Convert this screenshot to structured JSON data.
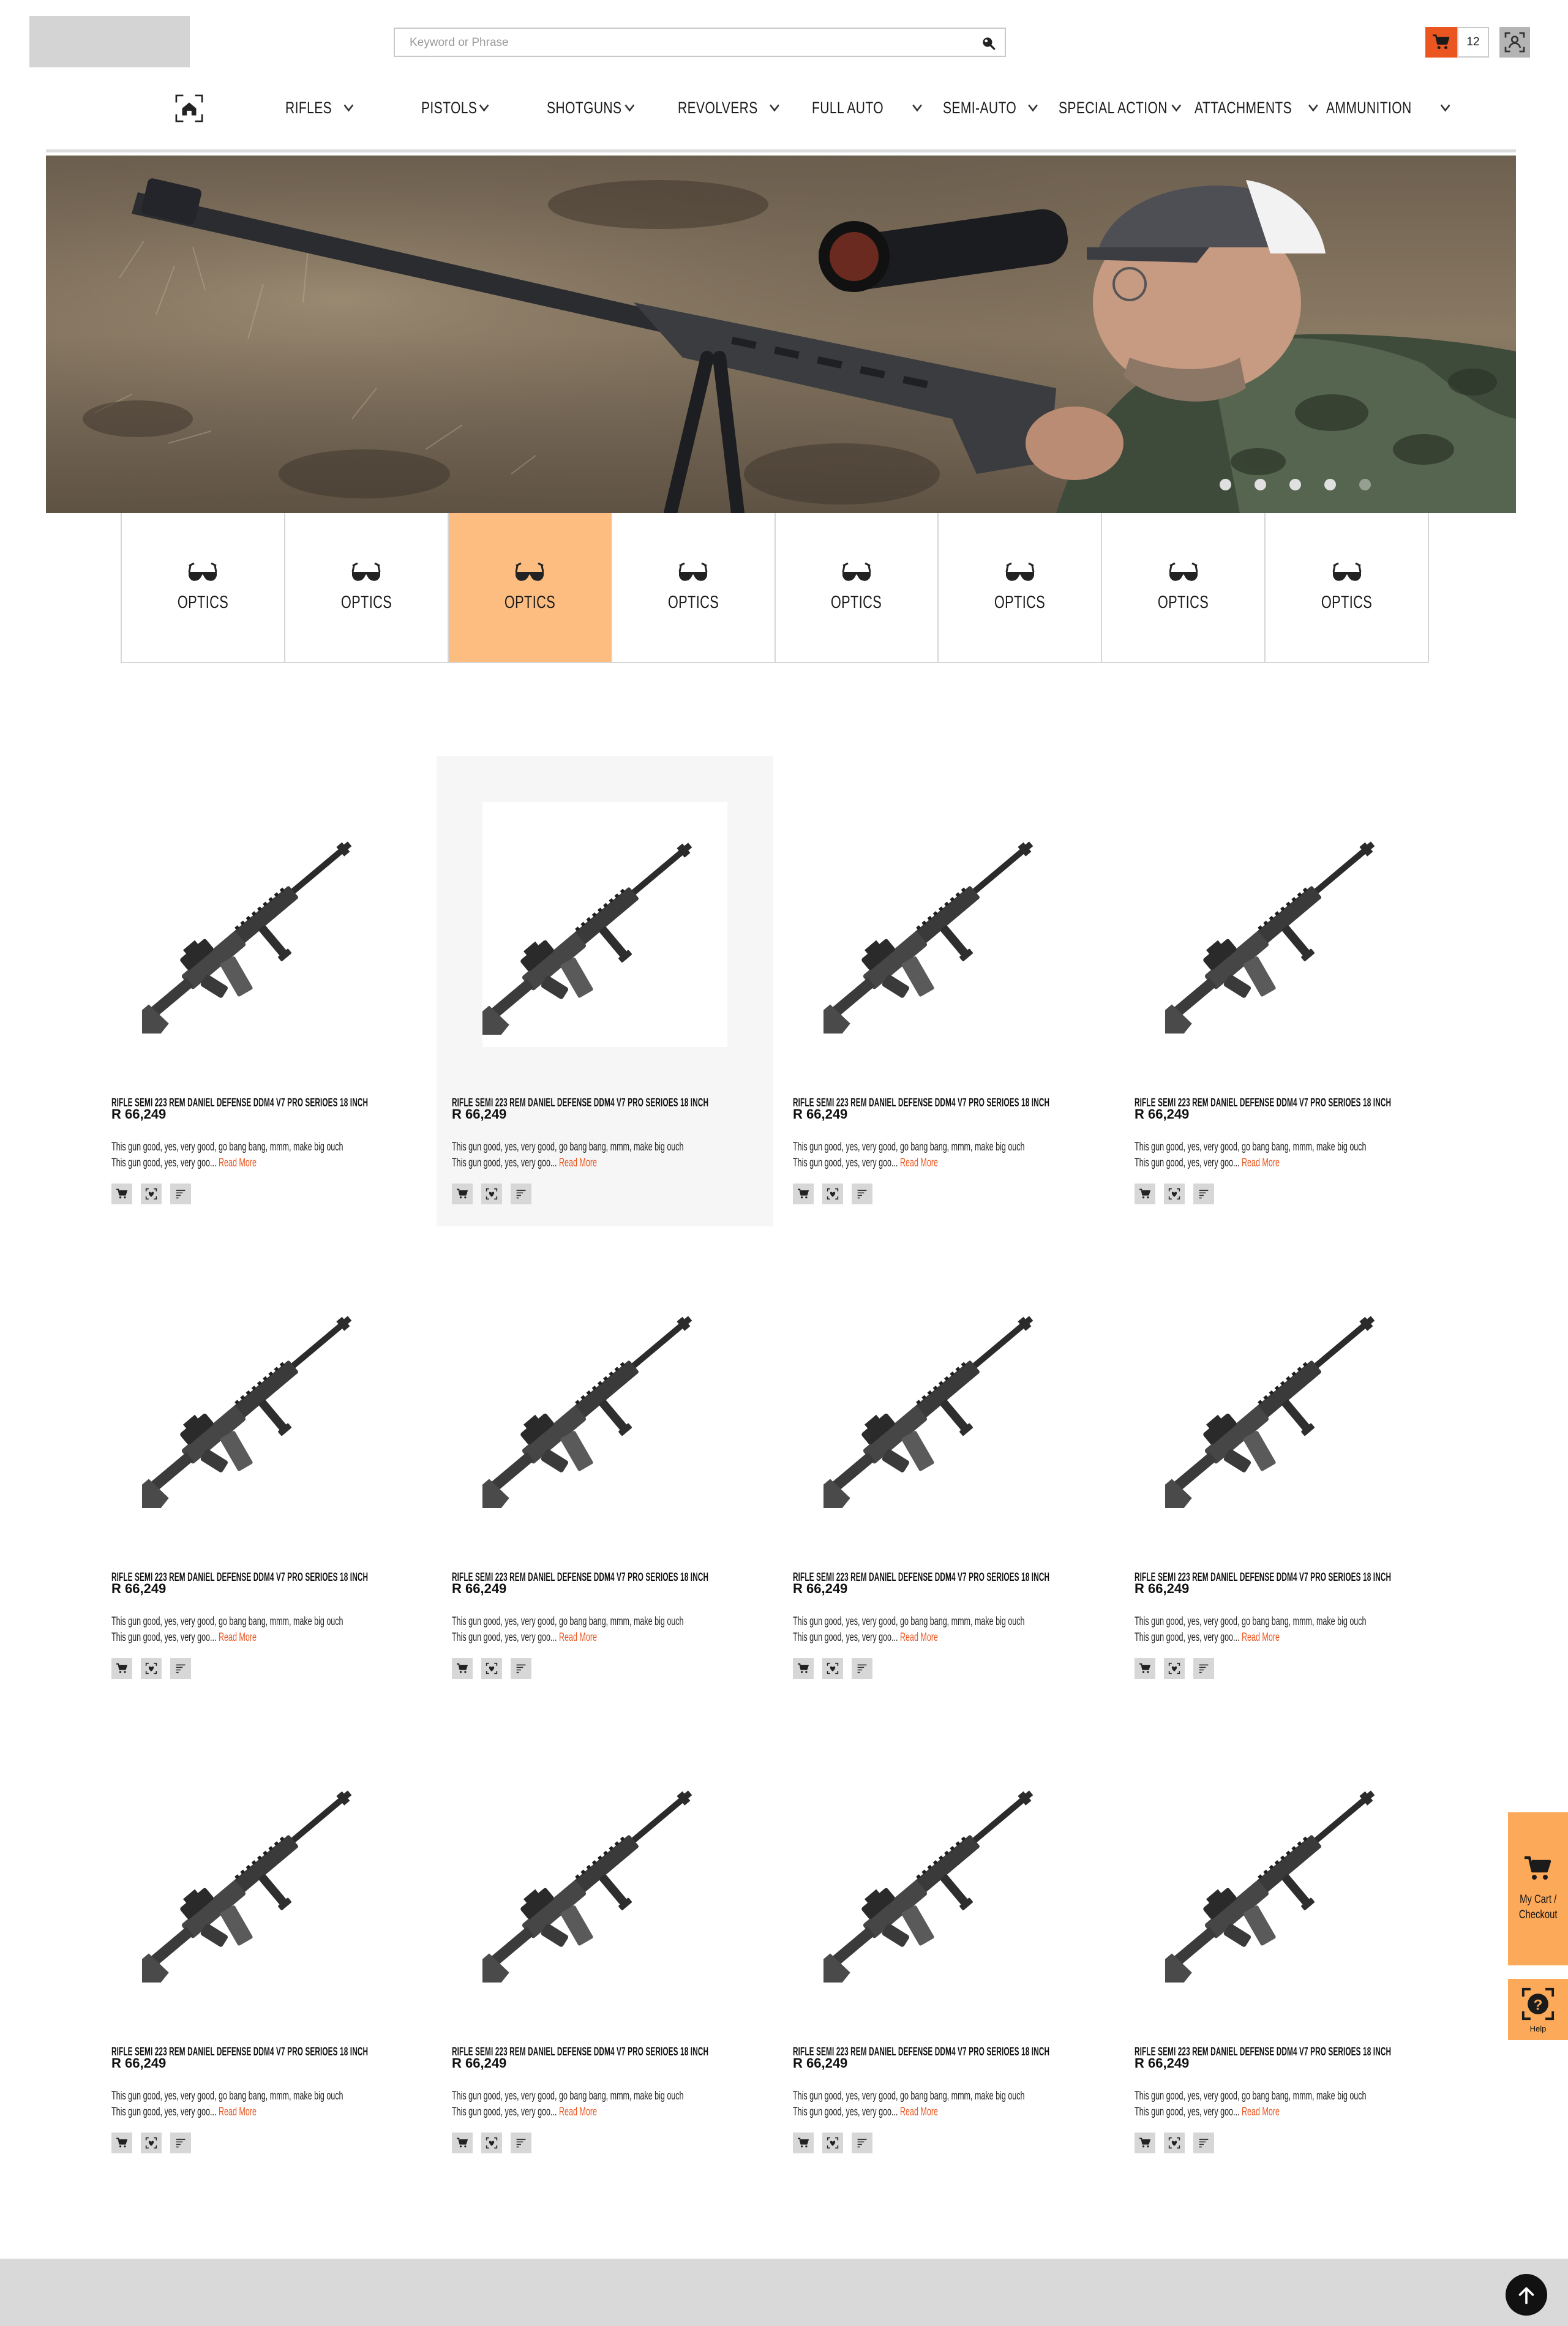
{
  "search": {
    "placeholder": "Keyword or Phrase"
  },
  "header": {
    "cart_count": "12"
  },
  "nav": {
    "items": [
      {
        "label": "RIFLES"
      },
      {
        "label": "PISTOLS"
      },
      {
        "label": "SHOTGUNS"
      },
      {
        "label": "REVOLVERS"
      },
      {
        "label": "FULL AUTO"
      },
      {
        "label": "SEMI-AUTO"
      },
      {
        "label": "SPECIAL ACTION"
      },
      {
        "label": "ATTACHMENTS"
      },
      {
        "label": "AMMUNITION"
      }
    ]
  },
  "hero": {
    "slide_count": 5,
    "active_slide": 1
  },
  "categories": [
    {
      "label": "OPTICS",
      "icon": "glasses-icon"
    },
    {
      "label": "OPTICS",
      "icon": "glasses-icon"
    },
    {
      "label": "OPTICS",
      "icon": "glasses-icon",
      "active": true
    },
    {
      "label": "OPTICS",
      "icon": "glasses-icon"
    },
    {
      "label": "OPTICS",
      "icon": "glasses-icon"
    },
    {
      "label": "OPTICS",
      "icon": "glasses-icon"
    },
    {
      "label": "OPTICS",
      "icon": "glasses-icon"
    },
    {
      "label": "OPTICS",
      "icon": "glasses-icon"
    }
  ],
  "product": {
    "title": "RIFLE SEMI 223 REM DANIEL DEFENSE DDM4 V7 PRO SERIOES 18 INCH",
    "price": "R 66,249",
    "desc_line1": "This gun good, yes, very good, go bang bang, mmm, make big ouch",
    "desc_line2": "This gun good, yes, very goo...",
    "read_more": "Read More"
  },
  "products": [
    {
      "row": 0,
      "col": 0
    },
    {
      "row": 0,
      "col": 1,
      "highlighted": true
    },
    {
      "row": 0,
      "col": 2
    },
    {
      "row": 0,
      "col": 3
    },
    {
      "row": 1,
      "col": 0
    },
    {
      "row": 1,
      "col": 1
    },
    {
      "row": 1,
      "col": 2
    },
    {
      "row": 1,
      "col": 3
    },
    {
      "row": 2,
      "col": 0
    },
    {
      "row": 2,
      "col": 1
    },
    {
      "row": 2,
      "col": 2
    },
    {
      "row": 2,
      "col": 3
    }
  ],
  "side": {
    "cart_line1": "My Cart /",
    "cart_line2": "Checkout",
    "help_label": "Help"
  },
  "colors": {
    "accent": "#ea5520",
    "category_active": "#fdbd80",
    "side_panel": "#fca959",
    "footer": "#d9d9d9"
  }
}
